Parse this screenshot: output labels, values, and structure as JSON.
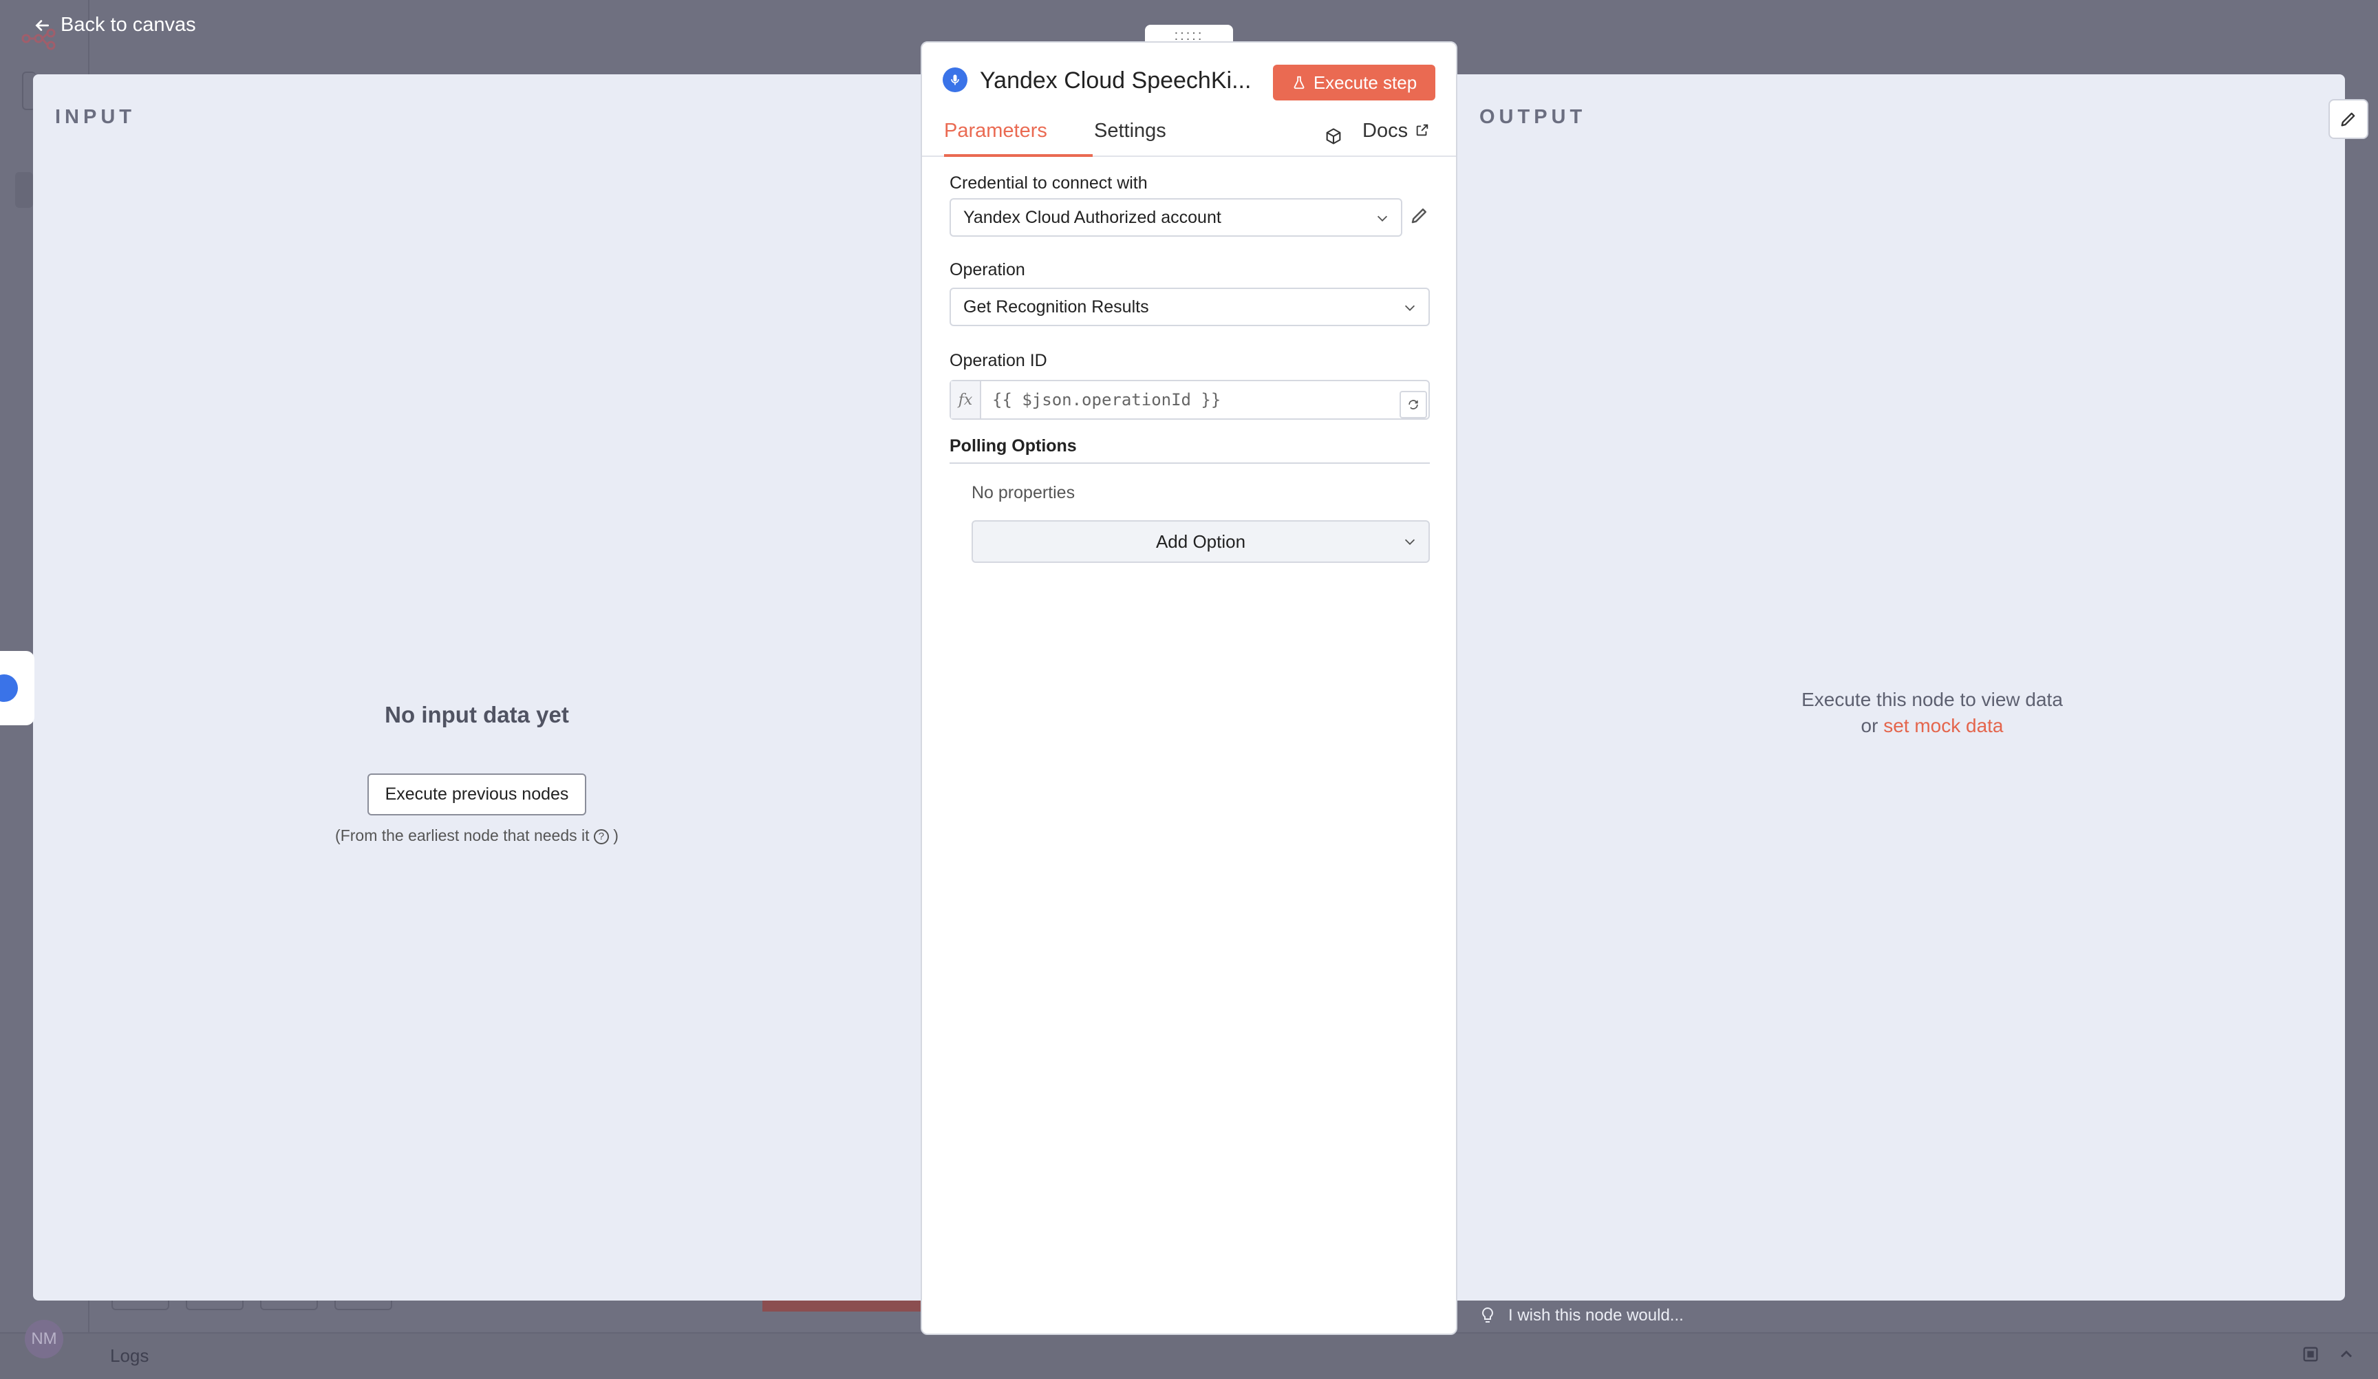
{
  "nav": {
    "back_label": "Back to canvas"
  },
  "background": {
    "logs_label": "Logs",
    "avatar_initials": "NM"
  },
  "input_panel": {
    "label": "INPUT",
    "empty_title": "No input data yet",
    "execute_previous_label": "Execute previous nodes",
    "hint_text": "(From the earliest node that needs it",
    "hint_icon": "question-circle-icon",
    "hint_close": ")"
  },
  "output_panel": {
    "label": "OUTPUT",
    "empty_line1": "Execute this node to view data",
    "empty_or": "or",
    "mock_link": "set mock data"
  },
  "node": {
    "title": "Yandex Cloud SpeechKi...",
    "icon": "microphone-icon",
    "accent": "#3a73e8",
    "execute_label": "Execute step"
  },
  "tabs": {
    "parameters": "Parameters",
    "settings": "Settings",
    "docs": "Docs"
  },
  "form": {
    "credential_label": "Credential to connect with",
    "credential_value": "Yandex Cloud Authorized account",
    "operation_label": "Operation",
    "operation_value": "Get Recognition Results",
    "operation_id_label": "Operation ID",
    "operation_id_value": "{{ $json.operationId }}",
    "fx_label": "fx",
    "polling_title": "Polling Options",
    "no_properties": "No properties",
    "add_option_label": "Add Option"
  },
  "footer": {
    "wish_label": "I wish this node would..."
  },
  "colors": {
    "primary": "#ea6a52",
    "backdrop": "#6f7080",
    "panel": "#e9ecf5"
  }
}
